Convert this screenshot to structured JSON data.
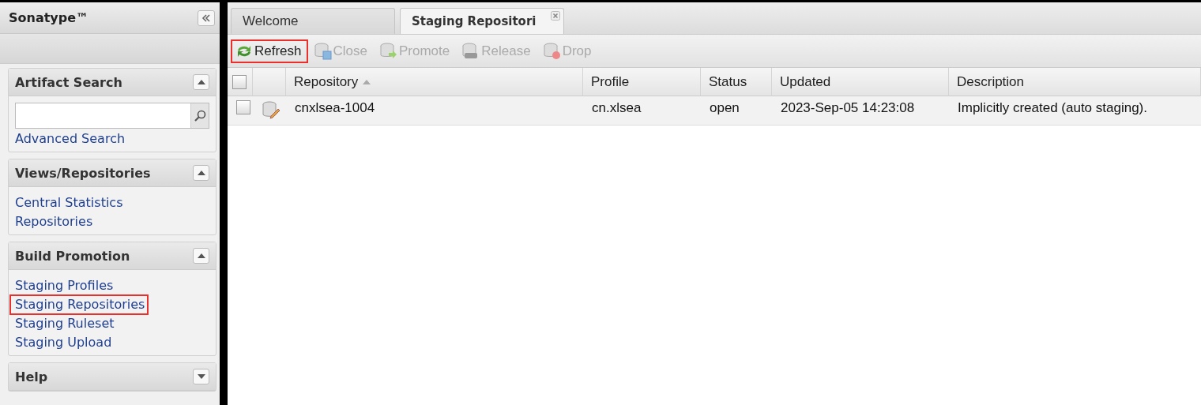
{
  "sidebar": {
    "title": "Sonatype™",
    "panels": [
      {
        "title": "Artifact Search",
        "kind": "search",
        "expanded": true,
        "links": [
          {
            "label": "Advanced Search",
            "highlighted": false
          }
        ]
      },
      {
        "title": "Views/Repositories",
        "expanded": true,
        "links": [
          {
            "label": "Central Statistics",
            "highlighted": false
          },
          {
            "label": "Repositories",
            "highlighted": false
          }
        ]
      },
      {
        "title": "Build Promotion",
        "expanded": true,
        "links": [
          {
            "label": "Staging Profiles",
            "highlighted": false
          },
          {
            "label": "Staging Repositories",
            "highlighted": true
          },
          {
            "label": "Staging Ruleset",
            "highlighted": false
          },
          {
            "label": "Staging Upload",
            "highlighted": false
          }
        ]
      },
      {
        "title": "Help",
        "expanded": false
      }
    ]
  },
  "tabs": [
    {
      "label": "Welcome",
      "selected": false,
      "closable": false
    },
    {
      "label": "Staging Repositori",
      "selected": true,
      "closable": true
    }
  ],
  "toolbar": [
    {
      "label": "Refresh",
      "kind": "refresh",
      "disabled": false,
      "highlighted": true
    },
    {
      "label": "Close",
      "kind": "close",
      "disabled": true,
      "highlighted": false
    },
    {
      "label": "Promote",
      "kind": "promote",
      "disabled": true,
      "highlighted": false
    },
    {
      "label": "Release",
      "kind": "release",
      "disabled": true,
      "highlighted": false
    },
    {
      "label": "Drop",
      "kind": "drop",
      "disabled": true,
      "highlighted": false
    }
  ],
  "table": {
    "all_checked": false,
    "columns": [
      {
        "label": "Repository",
        "sorted": true
      },
      {
        "label": "Profile",
        "sorted": false
      },
      {
        "label": "Status",
        "sorted": false
      },
      {
        "label": "Updated",
        "sorted": false
      },
      {
        "label": "Description",
        "sorted": false
      }
    ],
    "rows": [
      {
        "checked": false,
        "cells": [
          "cnxlsea-1004",
          "cn.xlsea",
          "open",
          "2023-Sep-05 14:23:08",
          "Implicitly created (auto staging)."
        ]
      }
    ]
  }
}
